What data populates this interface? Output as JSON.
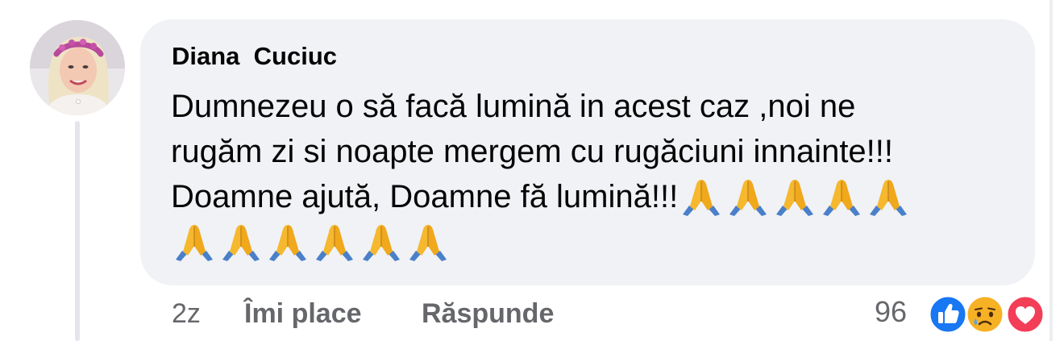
{
  "comment": {
    "author": "Diana  Cuciuc",
    "lines": [
      "Dumnezeu o să facă lumină in acest caz ,noi ne",
      "rugăm zi si noapte mergem cu rugăciuni innainte!!!",
      "Doamne ajută, Doamne fă lumină!!!"
    ],
    "emoji": "folded-hands",
    "emoji_count_line3": 5,
    "emoji_count_line4": 6
  },
  "actions": {
    "time": "2z",
    "like_label": "Îmi place",
    "reply_label": "Răspunde"
  },
  "reactions": {
    "count": "96",
    "icons": [
      "like-icon",
      "sad-icon",
      "love-icon"
    ],
    "colors": {
      "like": "#1877f2",
      "love": "#f33e58",
      "sad": "#f7b125"
    }
  },
  "colors": {
    "bubble": "#f0f2f5",
    "text": "#050505",
    "secondary": "#65676b"
  }
}
